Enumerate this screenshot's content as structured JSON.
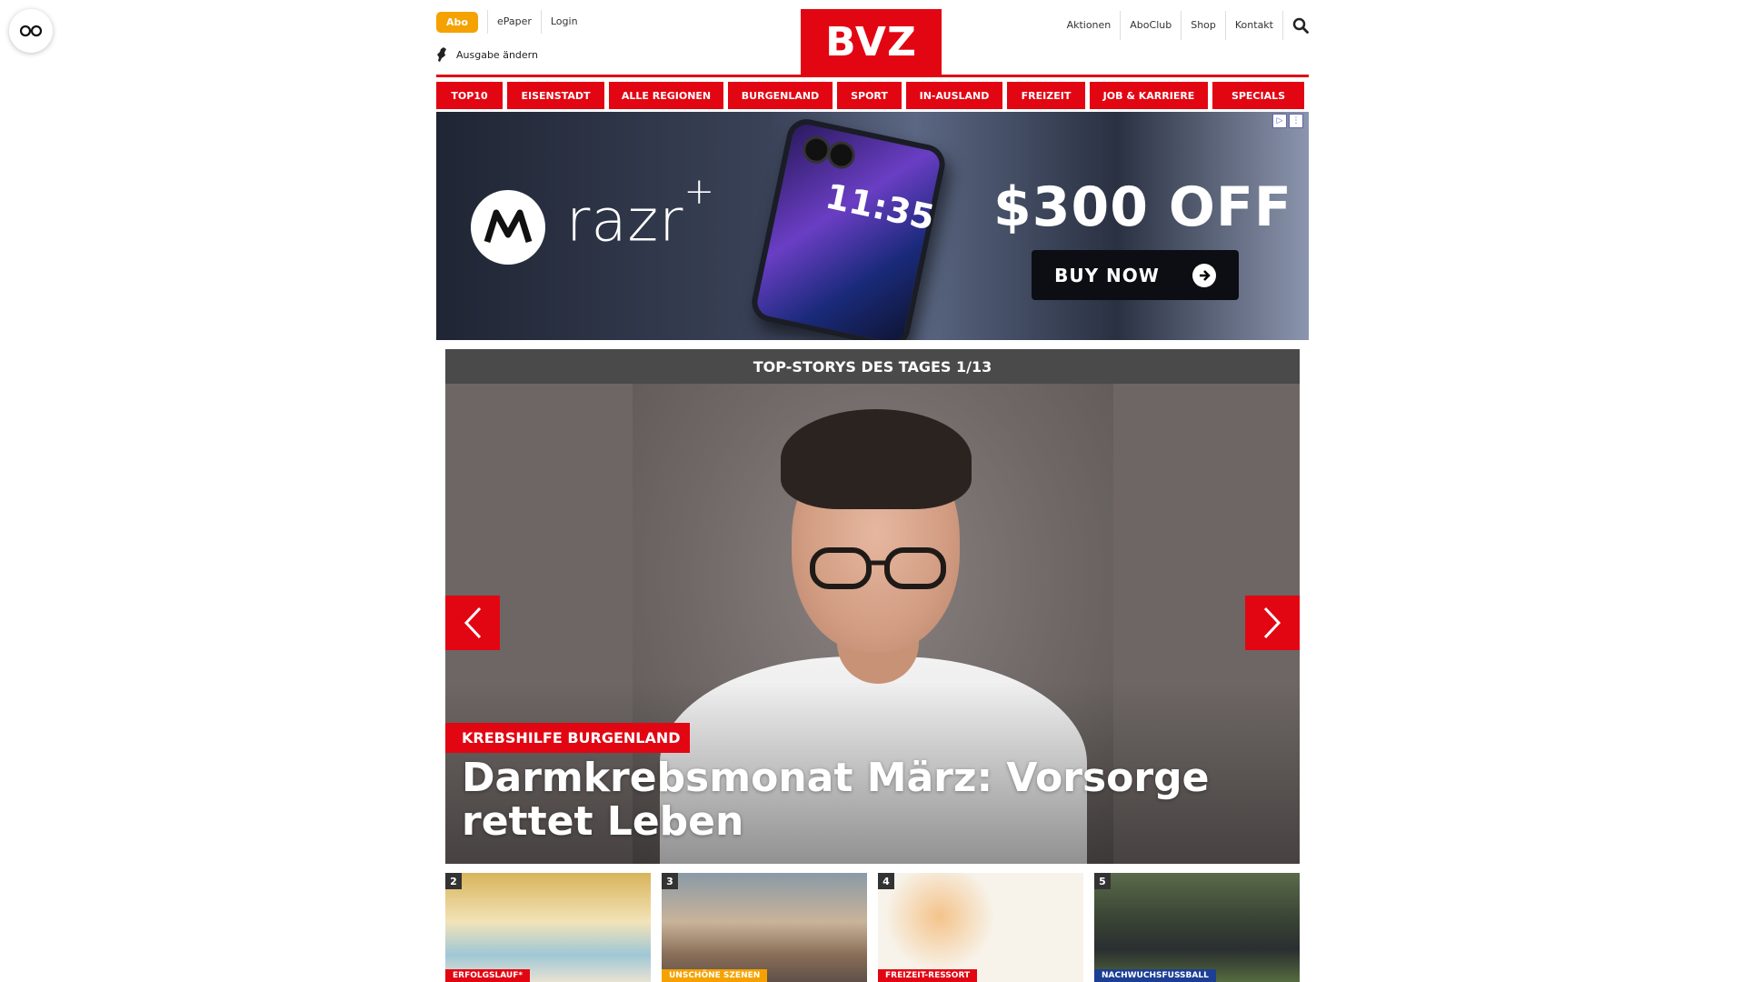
{
  "header": {
    "abo_label": "Abo",
    "epaper_label": "ePaper",
    "login_label": "Login",
    "edition_label": "Ausgabe ändern",
    "logo_text": "BVZ",
    "right_links": [
      "Aktionen",
      "AboClub",
      "Shop",
      "Kontakt"
    ],
    "search_icon": "search-icon"
  },
  "nav": {
    "items": [
      "TOP10",
      "EISENSTADT",
      "ALLE REGIONEN",
      "BURGENLAND",
      "SPORT",
      "IN-AUSLAND",
      "FREIZEIT",
      "JOB & KARRIERE",
      "SPECIALS"
    ]
  },
  "ad": {
    "brand": "razr",
    "brand_plus": "+",
    "phone_time": "11:35",
    "offer": "$300 OFF",
    "cta": "BUY NOW"
  },
  "carousel": {
    "title": "TOP-STORYS DES TAGES 1/13",
    "kicker": "KREBSHILFE BURGENLAND",
    "headline": "Darmkrebsmonat März: Vorsorge rettet Leben"
  },
  "thumbs": [
    {
      "num": "2",
      "tag": "ERFOLGSLAUF*"
    },
    {
      "num": "3",
      "tag": "UNSCHÖNE SZENEN"
    },
    {
      "num": "4",
      "tag": "FREIZEIT-RESSORT"
    },
    {
      "num": "5",
      "tag": "NACHWUCHSFUSSBALL"
    }
  ],
  "colors": {
    "brand_red": "#e20613",
    "abo_orange": "#f5a200",
    "carousel_header": "#4a4a4a"
  }
}
